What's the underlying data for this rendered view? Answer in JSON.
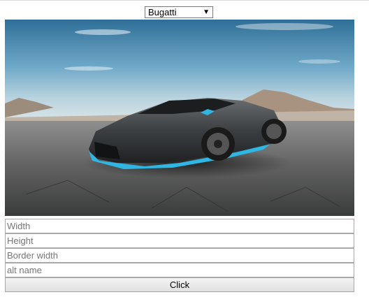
{
  "dropdown": {
    "selected": "Bugatti",
    "arrow": "▼"
  },
  "image": {
    "icon": "car-photo"
  },
  "form": {
    "width_placeholder": "Width",
    "height_placeholder": "Height",
    "border_width_placeholder": "Border width",
    "alt_name_placeholder": "alt name",
    "button_label": "Click"
  }
}
